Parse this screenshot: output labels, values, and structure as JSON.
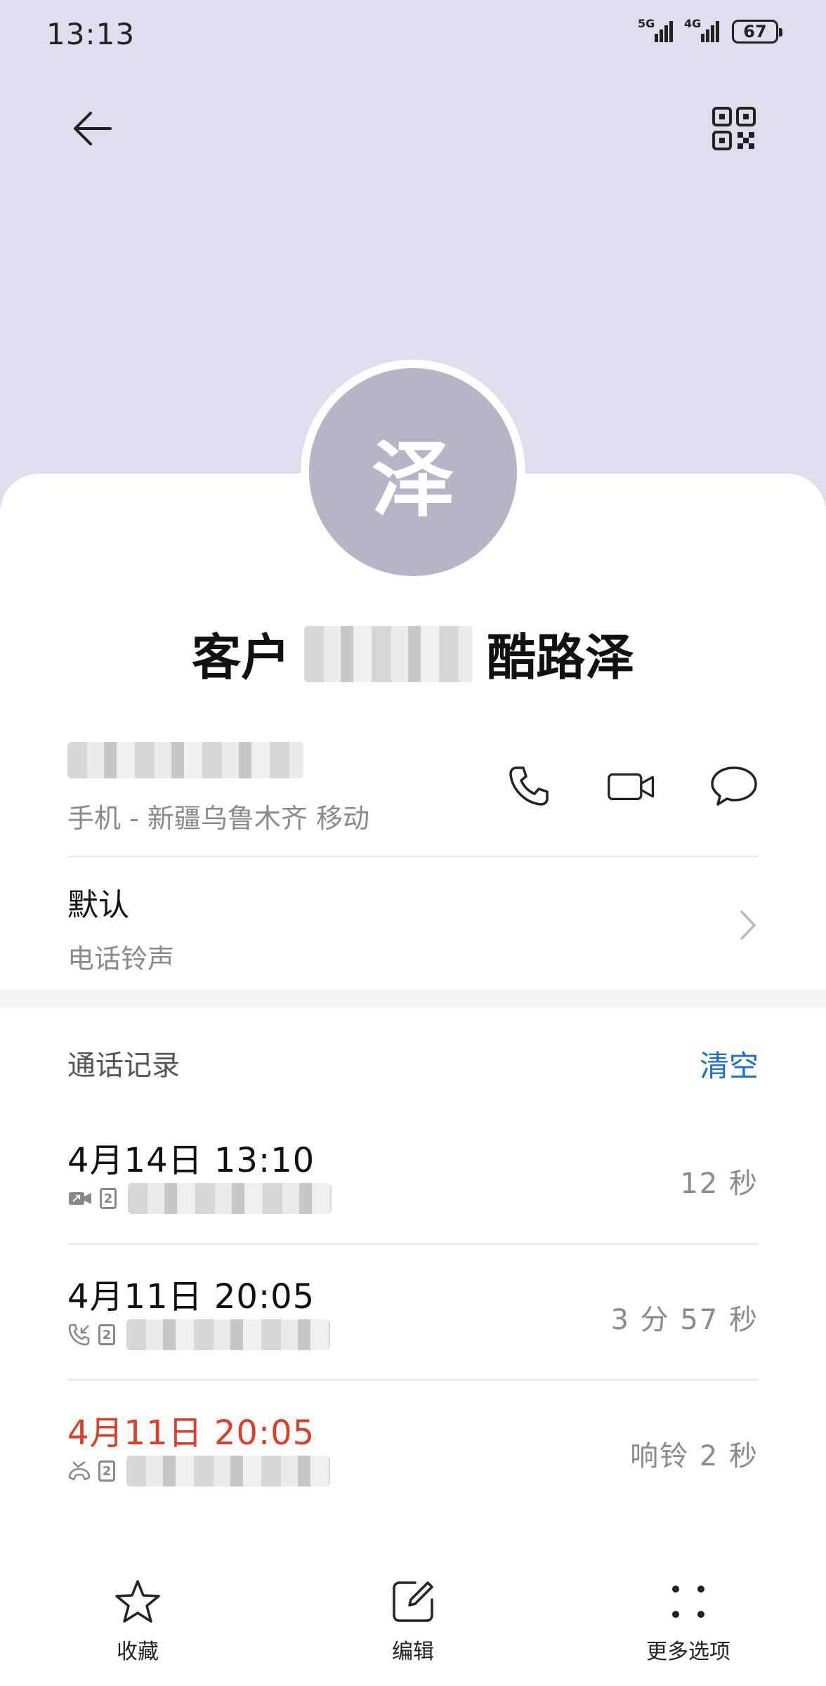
{
  "status_bar": {
    "time": "13:13",
    "signal_1_label": "5G",
    "signal_2_label": "4G",
    "battery": "67"
  },
  "header": {
    "back_icon": "arrow-left-icon",
    "qr_icon": "qr-code-icon"
  },
  "contact": {
    "avatar_letter": "泽",
    "name_prefix": "客户",
    "name_suffix": "酷路泽",
    "phone_sub": "手机 - 新疆乌鲁木齐 移动",
    "actions": [
      "phone-icon",
      "video-call-icon",
      "message-icon"
    ]
  },
  "ringtone": {
    "title": "默认",
    "subtitle": "电话铃声"
  },
  "calls": {
    "header": "通话记录",
    "clear_label": "清空",
    "items": [
      {
        "datetime": "4月14日 13:10",
        "duration": "12 秒",
        "type": "video-outgoing",
        "missed": false
      },
      {
        "datetime": "4月11日 20:05",
        "duration": "3 分 57 秒",
        "type": "incoming",
        "missed": false
      },
      {
        "datetime": "4月11日 20:05",
        "duration": "响铃 2 秒",
        "type": "missed",
        "missed": true
      }
    ],
    "sim_label": "2"
  },
  "bottom_bar": {
    "favorite_label": "收藏",
    "edit_label": "编辑",
    "more_label": "更多选项"
  },
  "colors": {
    "header_bg": "#e1dcee",
    "avatar_bg": "#b8b3c9",
    "accent_blue": "#1a6fcf",
    "missed_red": "#d8402a"
  }
}
